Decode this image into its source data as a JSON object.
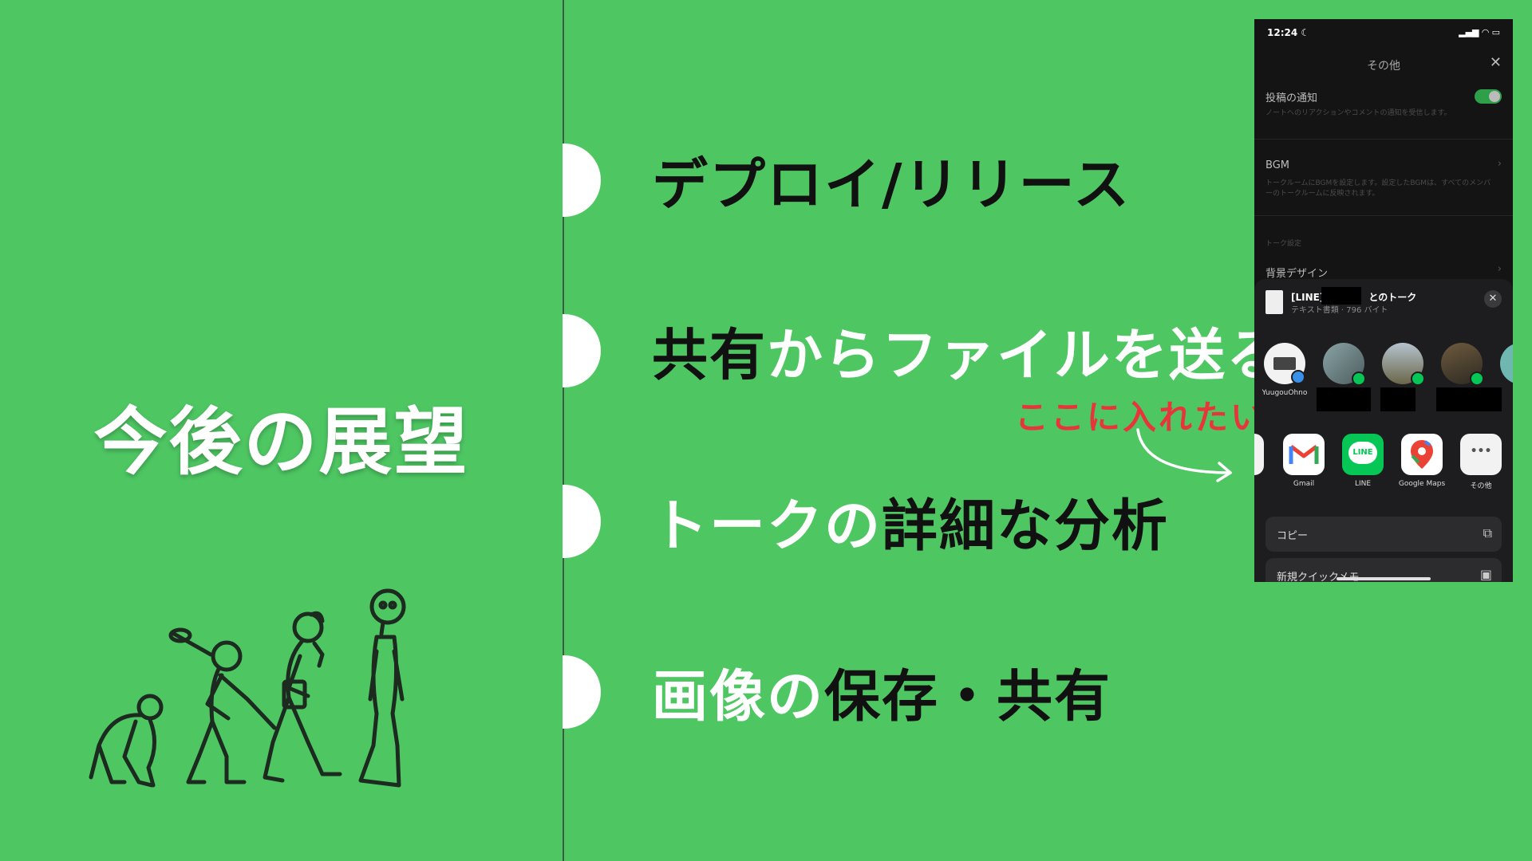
{
  "slide": {
    "title": "今後の展望",
    "items": [
      {
        "parts": [
          {
            "text": "デプロイ/リリース",
            "color": "dark"
          }
        ]
      },
      {
        "parts": [
          {
            "text": "共有",
            "color": "dark"
          },
          {
            "text": "からファイルを送る",
            "color": "white"
          }
        ]
      },
      {
        "parts": [
          {
            "text": "トークの",
            "color": "white"
          },
          {
            "text": "詳細な分析",
            "color": "dark"
          }
        ]
      },
      {
        "parts": [
          {
            "text": "画像の",
            "color": "white"
          },
          {
            "text": "保存・共有",
            "color": "dark"
          }
        ]
      }
    ],
    "annotation": "ここに入れたい",
    "evolution_icon": "human-evolution-icon"
  },
  "colors": {
    "background": "#4ec763",
    "dark_text": "#111111",
    "annotation": "#e8353b",
    "line_green": "#06c755"
  },
  "phone": {
    "status": {
      "time": "12:24 ☾",
      "icons": "▂▄▆ ◠ ▭"
    },
    "settings": {
      "title": "その他",
      "notify_label": "投稿の通知",
      "notify_sub": "ノートへのリアクションやコメントの通知を受信します。",
      "bgm_label": "BGM",
      "bgm_sub": "トークルームにBGMを設定します。設定したBGMは、すべてのメンバーのトークルームに反映されます。",
      "section_label": "トーク設定",
      "background_label": "背景デザイン"
    },
    "share": {
      "doc_title_prefix": "[LINE]",
      "doc_title_suffix": "とのトーク",
      "doc_subtitle": "テキスト書類 · 796 バイト",
      "people": [
        {
          "label": "YuugouOhno"
        },
        {
          "label": ""
        },
        {
          "label": ""
        },
        {
          "label": ""
        }
      ],
      "apps": [
        {
          "label": "Gmail",
          "icon": "gmail-icon"
        },
        {
          "label": "LINE",
          "icon": "line-icon",
          "icon_text": "LINE"
        },
        {
          "label": "Google Maps",
          "icon": "google-maps-icon"
        },
        {
          "label": "その他",
          "icon": "more-icon",
          "icon_text": "•••"
        }
      ],
      "actions": [
        {
          "label": "コピー",
          "icon": "copy-icon"
        },
        {
          "label": "新規クイックメモ",
          "icon": "quick-note-icon"
        }
      ]
    }
  }
}
